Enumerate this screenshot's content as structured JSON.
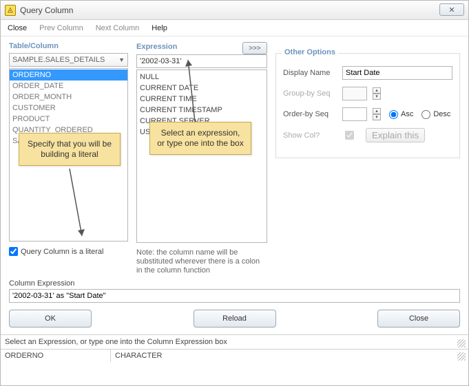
{
  "window": {
    "title": "Query Column"
  },
  "menubar": {
    "close": "Close",
    "prev": "Prev Column",
    "next": "Next Column",
    "help": "Help"
  },
  "tablecol": {
    "label": "Table/Column",
    "dropdown": "SAMPLE.SALES_DETAILS",
    "items": [
      "ORDERNO",
      "ORDER_DATE",
      "ORDER_MONTH",
      "CUSTOMER",
      "PRODUCT",
      "QUANTITY_ORDERED",
      "SALE_AMOUNT"
    ],
    "selected_index": 0,
    "literal_label": "Query Column is a literal",
    "literal_checked": true
  },
  "expression": {
    "label": "Expression",
    "more": ">>>",
    "value": "'2002-03-31'",
    "items": [
      "NULL",
      "CURRENT DATE",
      "CURRENT TIME",
      "CURRENT TIMESTAMP",
      "CURRENT SERVER",
      "USER"
    ],
    "note": "Note: the column name will be substituted wherever there is a colon in the column function"
  },
  "options": {
    "legend": "Other Options",
    "display_name_label": "Display Name",
    "display_name": "Start Date",
    "group_by_label": "Group-by Seq",
    "group_by": "",
    "order_by_label": "Order-by Seq",
    "order_by": "",
    "asc": "Asc",
    "desc": "Desc",
    "show_label": "Show Col?",
    "show_checked": true,
    "explain": "Explain this"
  },
  "column_expression": {
    "label": "Column Expression",
    "value": "'2002-03-31' as \"Start Date\""
  },
  "buttons": {
    "ok": "OK",
    "reload": "Reload",
    "close": "Close"
  },
  "status": {
    "hint": "Select an Expression, or type one into the Column Expression box",
    "col": "ORDERNO",
    "type": "CHARACTER"
  },
  "callouts": {
    "c1": "Specify that you will be building a literal",
    "c2": "Select an expression, or type one into the box"
  }
}
